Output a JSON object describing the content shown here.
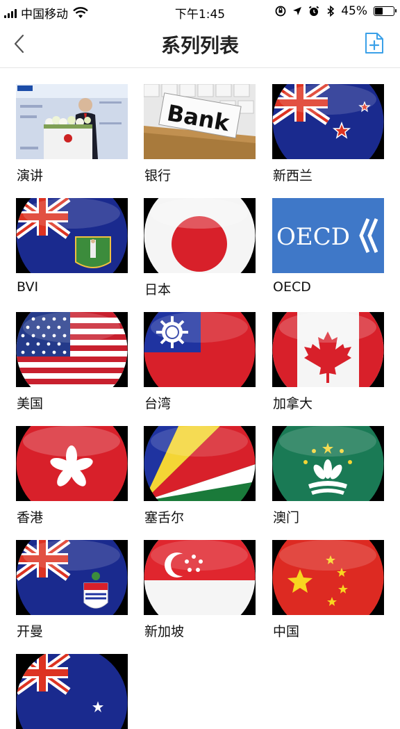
{
  "status_bar": {
    "carrier": "中国移动",
    "time": "下午1:45",
    "battery_percent": "45%",
    "battery_level": 0.45
  },
  "nav": {
    "title": "系列列表",
    "back_icon": "chevron-left-icon",
    "add_icon": "add-document-icon",
    "accent_color": "#3aa0e8"
  },
  "series": [
    {
      "label": "演讲",
      "thumb": "speech"
    },
    {
      "label": "银行",
      "thumb": "bank"
    },
    {
      "label": "新西兰",
      "thumb": "nz"
    },
    {
      "label": "BVI",
      "thumb": "bvi"
    },
    {
      "label": "日本",
      "thumb": "japan"
    },
    {
      "label": "OECD",
      "thumb": "oecd"
    },
    {
      "label": "美国",
      "thumb": "usa"
    },
    {
      "label": "台湾",
      "thumb": "taiwan"
    },
    {
      "label": "加拿大",
      "thumb": "canada"
    },
    {
      "label": "香港",
      "thumb": "hk"
    },
    {
      "label": "塞舌尔",
      "thumb": "seychelles"
    },
    {
      "label": "澳门",
      "thumb": "macau"
    },
    {
      "label": "开曼",
      "thumb": "cayman"
    },
    {
      "label": "新加坡",
      "thumb": "singapore"
    },
    {
      "label": "中国",
      "thumb": "china"
    },
    {
      "label": "",
      "thumb": "australia"
    }
  ],
  "thumb_text": {
    "bank": "Bank",
    "oecd": "OECD"
  }
}
